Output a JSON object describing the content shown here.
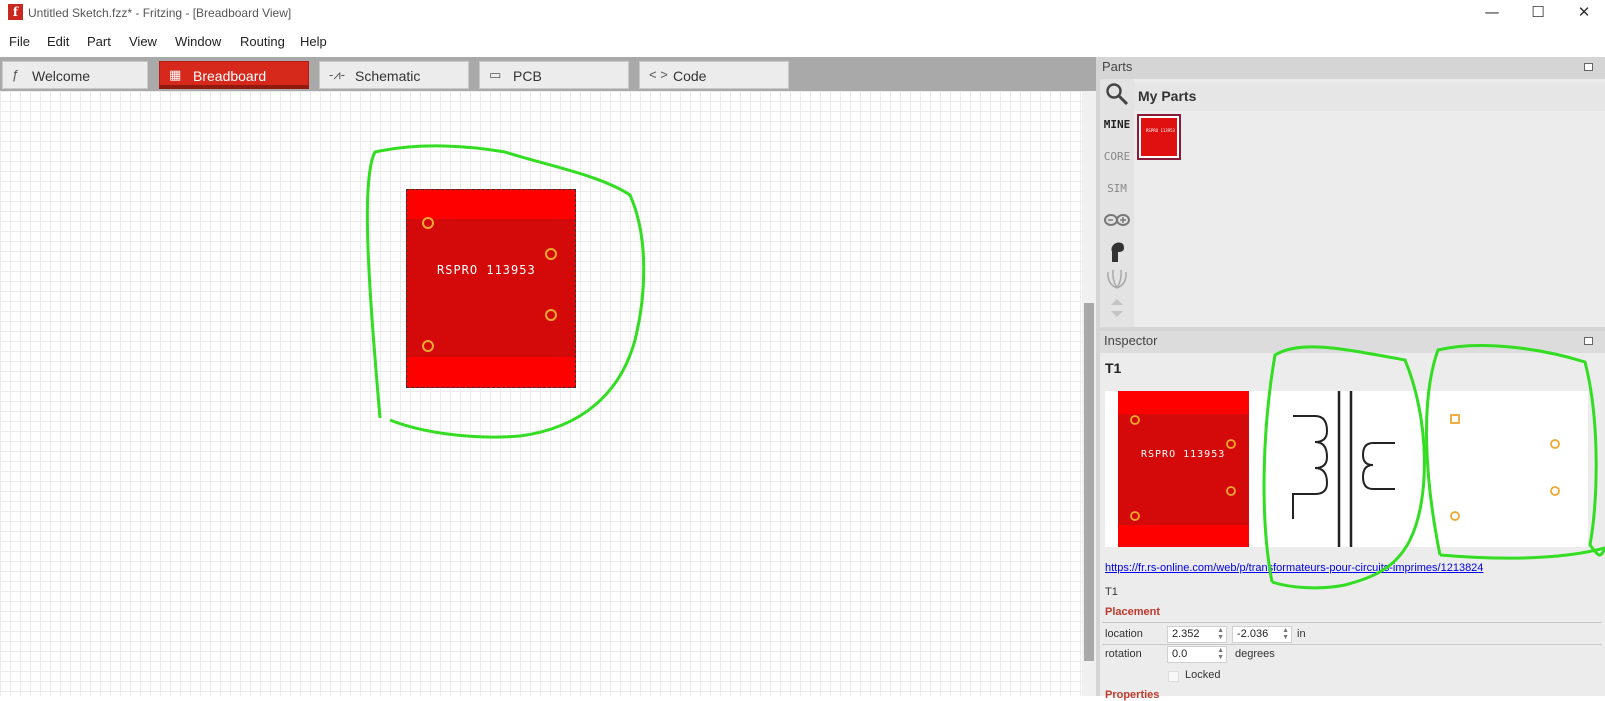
{
  "window": {
    "title": "Untitled Sketch.fzz* - Fritzing - [Breadboard View]",
    "app_icon_letter": "f",
    "minimize_glyph": "—",
    "maximize_glyph": "☐",
    "close_glyph": "✕"
  },
  "menu": {
    "items": [
      "File",
      "Edit",
      "Part",
      "View",
      "Window",
      "Routing",
      "Help"
    ]
  },
  "tabs": [
    {
      "label": "Welcome",
      "icon": "fritzing-f-icon",
      "glyph": "ƒ",
      "active": false
    },
    {
      "label": "Breadboard",
      "icon": "breadboard-grid-icon",
      "glyph": "▦",
      "active": true
    },
    {
      "label": "Schematic",
      "icon": "resistor-icon",
      "glyph": "-⩘-",
      "active": false
    },
    {
      "label": "PCB",
      "icon": "pcb-icon",
      "glyph": "▭",
      "active": false
    },
    {
      "label": "Code",
      "icon": "code-brackets-icon",
      "glyph": "< >",
      "active": false
    }
  ],
  "canvas": {
    "part": {
      "label": "RSPRO 113953",
      "pins": 4,
      "colors": {
        "board": "#ff0000",
        "body": "#d40a0a",
        "pin": "#f0a830"
      }
    }
  },
  "parts_panel": {
    "title": "Parts",
    "bin_title": "My Parts",
    "bins": [
      "MINE",
      "CORE",
      "SIM",
      "arduino-icon",
      "fritzing-hand-icon",
      "seeed-icon"
    ],
    "bins_text": {
      "mine": "MINE",
      "core": "CORE",
      "sim": "SIM"
    },
    "search_icon": "magnifier-icon",
    "thumb_caption": "RSPRO 113953"
  },
  "inspector": {
    "title": "Inspector",
    "part_title": "T1",
    "views": [
      "breadboard",
      "schematic",
      "pcb"
    ],
    "url": "https://fr.rs-online.com/web/p/transformateurs-pour-circuits-imprimes/1213824",
    "part_label": "T1",
    "placement": {
      "header": "Placement",
      "location_label": "location",
      "location_x": "2.352",
      "location_y": "-2.036",
      "location_unit": "in",
      "rotation_label": "rotation",
      "rotation_value": "0.0",
      "rotation_unit": "degrees",
      "locked_label": "Locked"
    },
    "next_section": "Properties"
  },
  "accent": {
    "active_tab": "#d6291c",
    "annotation": "#33dd22",
    "section_header": "#c0392b"
  }
}
